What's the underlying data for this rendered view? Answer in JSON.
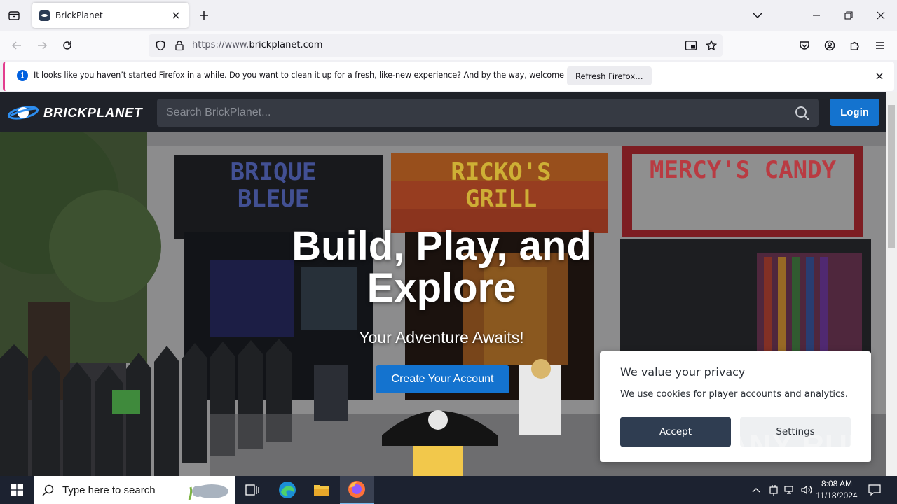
{
  "browser": {
    "tab_title": "BrickPlanet",
    "url_prefix": "https://www.",
    "url_domain": "brickplanet.com",
    "notification": {
      "message": "It looks like you haven’t started Firefox in a while. Do you want to clean it up for a fresh, like-new experience? And by the way, welcome back!",
      "button": "Refresh Firefox…"
    }
  },
  "site": {
    "logo_text": "BRICKPLANET",
    "search_placeholder": "Search BrickPlanet...",
    "login_label": "Login",
    "hero": {
      "title": "Build, Play, and Explore",
      "subtitle": "Your Adventure Awaits!",
      "cta": "Create Your Account"
    },
    "store_signs": [
      "BRIQUE BLEUE",
      "RICKO'S GRILL",
      "MERCY'S CANDY"
    ],
    "cookie": {
      "title": "We value your privacy",
      "text": "We use cookies for player accounts and analytics.",
      "accept": "Accept",
      "settings": "Settings"
    }
  },
  "watermark": "ANY RUN",
  "taskbar": {
    "search_placeholder": "Type here to search",
    "time": "8:08 AM",
    "date": "11/18/2024"
  },
  "colors": {
    "brand_blue": "#1473cf",
    "header_dark": "#1f2229",
    "cookie_accept": "#2f3d51"
  }
}
